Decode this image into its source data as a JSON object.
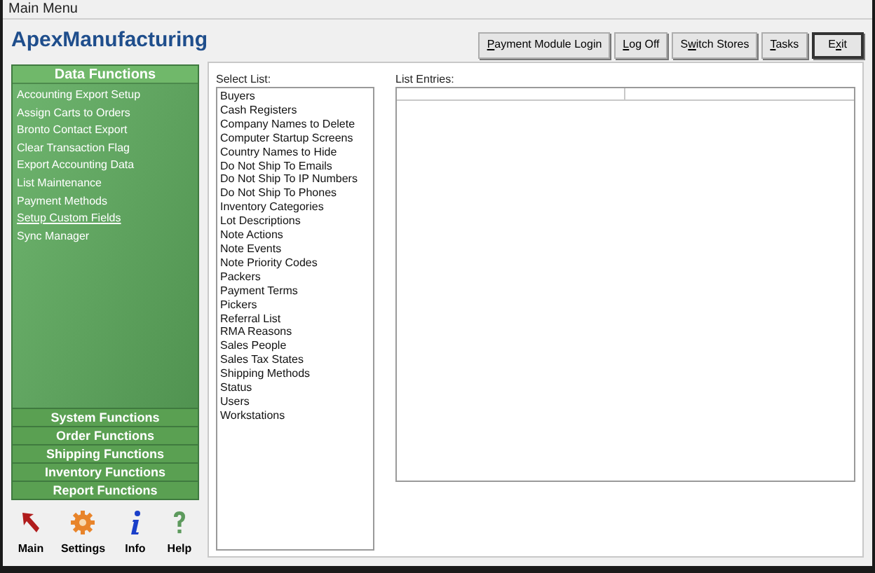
{
  "window": {
    "title": "Main Menu"
  },
  "app_title": "ApexManufacturing",
  "toolbar_buttons": [
    {
      "key": "P",
      "after": "ayment Module Login",
      "default": false
    },
    {
      "key": "L",
      "after": "og Off",
      "default": false
    },
    {
      "before": "S",
      "key": "w",
      "after": "itch Stores",
      "default": false
    },
    {
      "key": "T",
      "after": "asks",
      "default": false
    },
    {
      "before": "E",
      "key": "x",
      "after": "it",
      "default": true
    }
  ],
  "sidebar": {
    "header": "Data Functions",
    "items": [
      {
        "label": "Accounting Export Setup",
        "selected": false
      },
      {
        "label": "Assign Carts to Orders",
        "selected": false
      },
      {
        "label": "Bronto Contact Export",
        "selected": false
      },
      {
        "label": "Clear Transaction Flag",
        "selected": false
      },
      {
        "label": "Export Accounting Data",
        "selected": false
      },
      {
        "label": "List Maintenance",
        "selected": false
      },
      {
        "label": "Payment Methods",
        "selected": false
      },
      {
        "label": "Setup Custom Fields",
        "selected": true
      },
      {
        "label": "Sync Manager",
        "selected": false
      }
    ],
    "sections": [
      "System Functions",
      "Order Functions",
      "Shipping Functions",
      "Inventory Functions",
      "Report Functions"
    ]
  },
  "shortcuts": [
    {
      "kind": "arrow",
      "label": "Main"
    },
    {
      "kind": "gear",
      "label": "Settings"
    },
    {
      "kind": "info",
      "label": "Info"
    },
    {
      "kind": "help",
      "label": "Help"
    }
  ],
  "select_list": {
    "label": "Select List:",
    "items": [
      "Buyers",
      "Cash Registers",
      "Company Names to Delete",
      "Computer Startup Screens",
      "Country Names to Hide",
      "Do Not Ship To Emails",
      "Do Not Ship To IP Numbers",
      "Do Not Ship To Phones",
      "Inventory Categories",
      "Lot Descriptions",
      "Note Actions",
      "Note Events",
      "Note Priority Codes",
      "Packers",
      "Payment Terms",
      "Pickers",
      "Referral List",
      "RMA Reasons",
      "Sales People",
      "Sales Tax States",
      "Shipping Methods",
      "Status",
      "Users",
      "Workstations"
    ]
  },
  "list_entries": {
    "label": "List Entries:"
  }
}
